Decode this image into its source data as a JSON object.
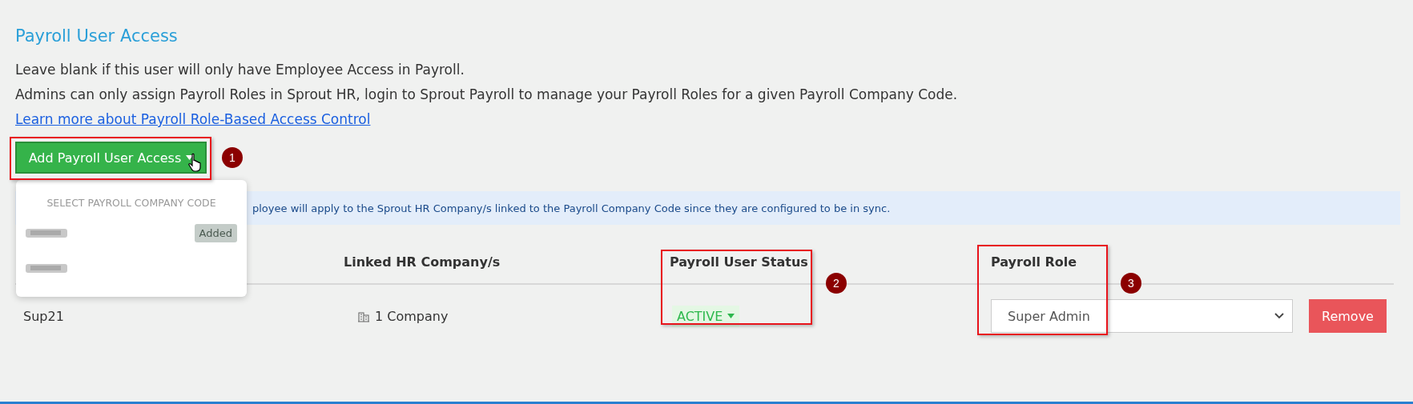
{
  "section": {
    "title": "Payroll User Access",
    "lines": [
      "Leave blank if this user will only have Employee Access in Payroll.",
      "Admins can only assign Payroll Roles in Sprout HR, login to Sprout Payroll to manage your Payroll Roles for a given Payroll Company Code."
    ],
    "link": "Learn more about Payroll Role-Based Access Control"
  },
  "add_button": {
    "label": "Add Payroll User Access",
    "expanded": true
  },
  "dropdown": {
    "header": "SELECT PAYROLL COMPANY CODE",
    "items": [
      {
        "added": true,
        "badge": "Added"
      },
      {
        "added": false
      }
    ]
  },
  "info_bar": {
    "text": "ployee will apply to the Sprout HR Company/s linked to the Payroll Company Code since they are configured to be in sync."
  },
  "table": {
    "columns": [
      "Linked HR Company/s",
      "Payroll User Status",
      "Payroll Role"
    ],
    "rows": [
      {
        "code": "Sup21",
        "companies": "1 Company",
        "status": "ACTIVE",
        "role": "Super Admin",
        "action": "Remove"
      }
    ]
  },
  "annotations": [
    "1",
    "2",
    "3"
  ]
}
